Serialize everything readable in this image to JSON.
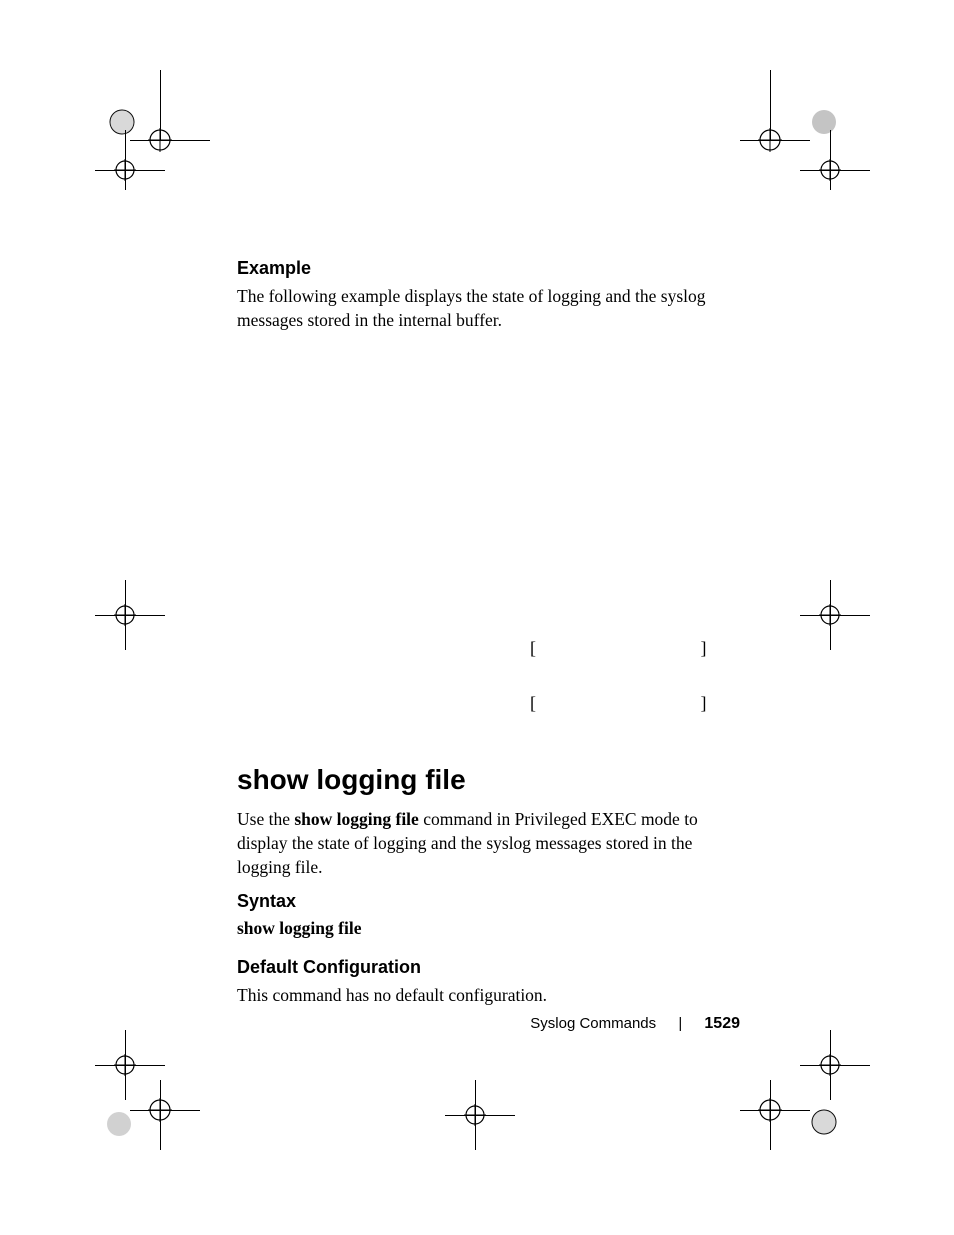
{
  "section1": {
    "heading": "Example",
    "body": "The following example displays the state of logging and the syslog messages stored in the internal buffer."
  },
  "brackets": {
    "b1": "[            ]",
    "b2": "[            ]"
  },
  "section2": {
    "title": "show logging file",
    "intro_prefix": "Use the ",
    "intro_cmd": "show logging file",
    "intro_suffix": " command in Privileged EXEC mode to display the state of logging and the syslog messages stored in the logging file.",
    "syntax_heading": "Syntax",
    "syntax_cmd": "show logging file",
    "default_heading": "Default Configuration",
    "default_body": "This command has no default configuration."
  },
  "footer": {
    "chapter": "Syslog Commands",
    "separator": "|",
    "page": "1529"
  }
}
